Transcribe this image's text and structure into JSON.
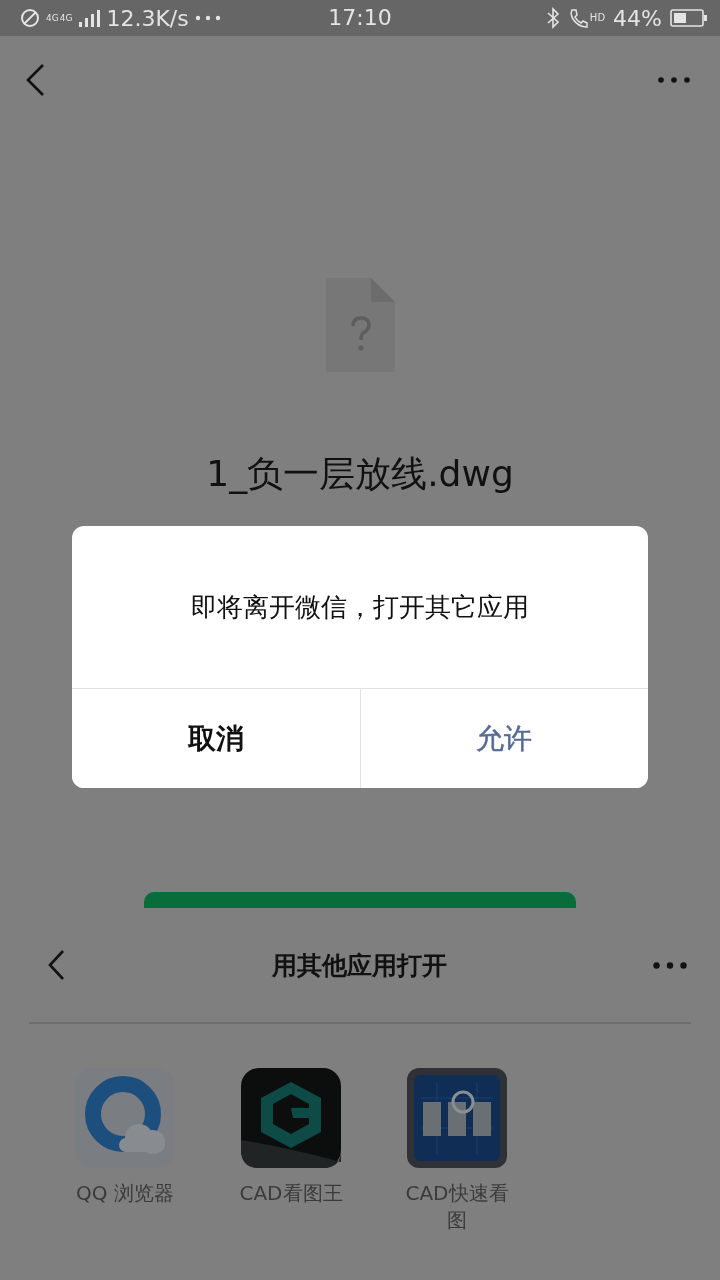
{
  "status_bar": {
    "network_labels": [
      "4G",
      "4G"
    ],
    "speed": "12.3K/s",
    "time": "17:10",
    "call_label": "HD",
    "battery": "44%"
  },
  "file": {
    "name": "1_负一层放线.dwg"
  },
  "dialog": {
    "message": "即将离开微信，打开其它应用",
    "buttons": [
      {
        "label": "取消",
        "primary": false
      },
      {
        "label": "允许",
        "primary": true
      }
    ]
  },
  "sheet": {
    "title": "用其他应用打开",
    "apps": [
      {
        "label": "QQ 浏览器",
        "kind": "browser"
      },
      {
        "label": "CAD看图王",
        "kind": "cube"
      },
      {
        "label": "CAD快速看图",
        "kind": "blueprint"
      }
    ]
  }
}
